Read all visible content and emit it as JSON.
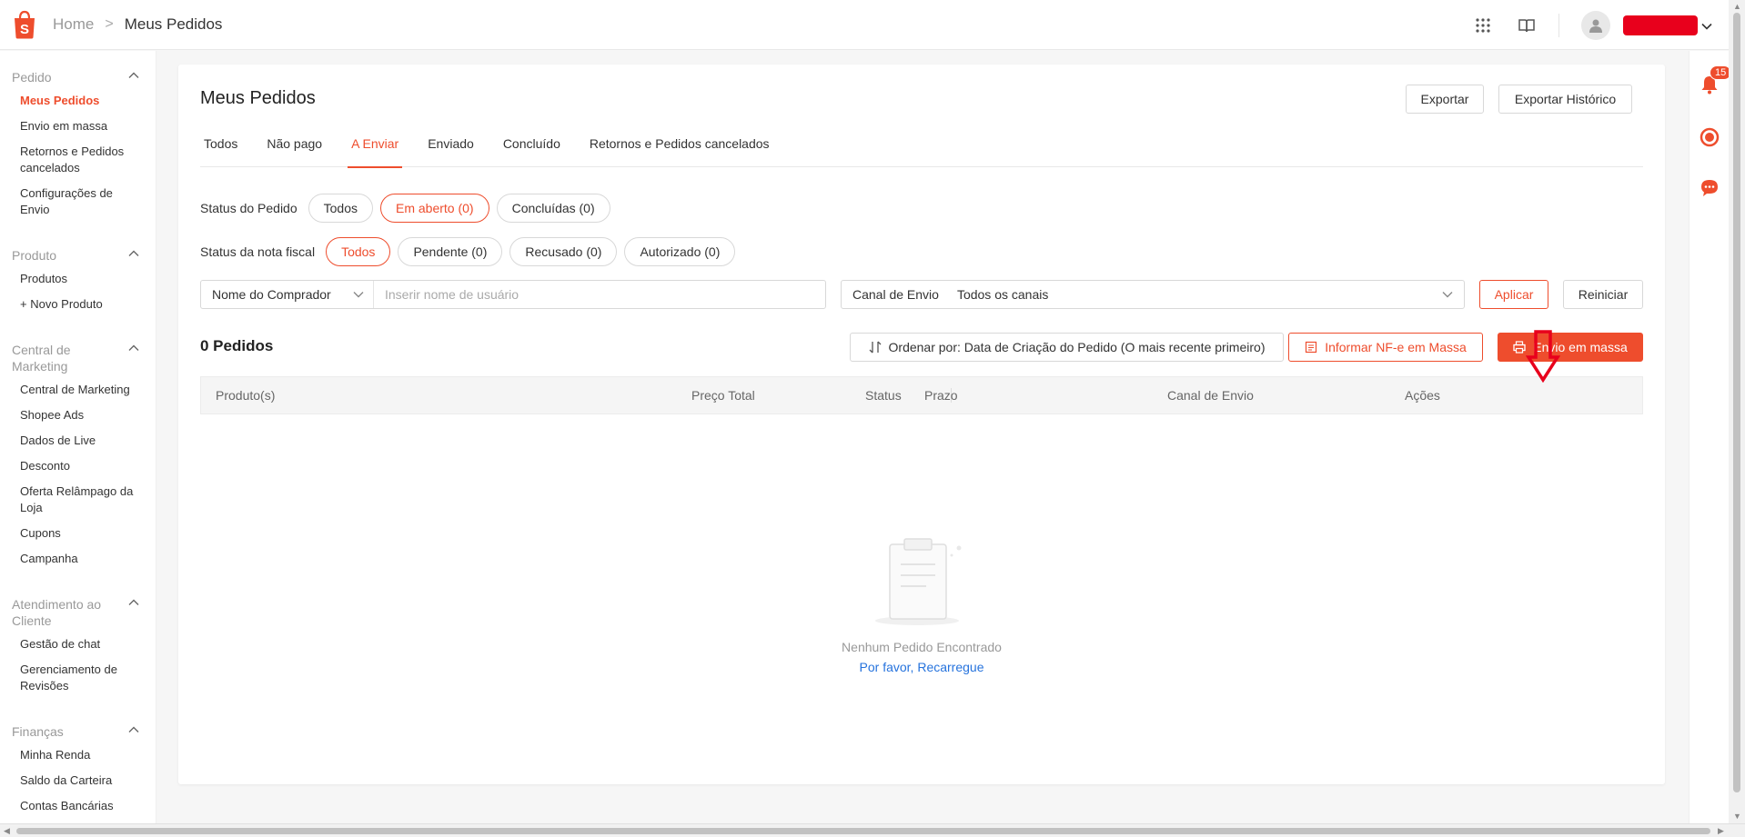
{
  "header": {
    "breadcrumb_home": "Home",
    "breadcrumb_separator": ">",
    "breadcrumb_current": "Meus Pedidos"
  },
  "sidebar": {
    "groups": [
      {
        "title": "Pedido",
        "items": [
          "Meus Pedidos",
          "Envio em massa",
          "Retornos e Pedidos cancelados",
          "Configurações de Envio"
        ]
      },
      {
        "title": "Produto",
        "items": [
          "Produtos",
          "+ Novo Produto"
        ]
      },
      {
        "title": "Central de Marketing",
        "items": [
          "Central de Marketing",
          "Shopee Ads",
          "Dados de Live",
          "Desconto",
          "Oferta Relâmpago da Loja",
          "Cupons",
          "Campanha"
        ]
      },
      {
        "title": "Atendimento ao Cliente",
        "items": [
          "Gestão de chat",
          "Gerenciamento de Revisões"
        ]
      },
      {
        "title": "Finanças",
        "items": [
          "Minha Renda",
          "Saldo da Carteira",
          "Contas Bancárias"
        ]
      }
    ],
    "active_item": "Meus Pedidos"
  },
  "notifications": {
    "count": "15"
  },
  "main": {
    "title": "Meus Pedidos",
    "export_label": "Exportar",
    "export_history_label": "Exportar Histórico",
    "tabs": [
      "Todos",
      "Não pago",
      "A Enviar",
      "Enviado",
      "Concluído",
      "Retornos e Pedidos cancelados"
    ],
    "active_tab": "A Enviar",
    "order_status": {
      "label": "Status do Pedido",
      "options": [
        "Todos",
        "Em aberto (0)",
        "Concluídas (0)"
      ],
      "active": "Em aberto (0)"
    },
    "invoice_status": {
      "label": "Status da nota fiscal",
      "options": [
        "Todos",
        "Pendente (0)",
        "Recusado (0)",
        "Autorizado (0)"
      ],
      "active": "Todos"
    },
    "search": {
      "field": "Nome do Comprador",
      "placeholder": "Inserir nome de usuário"
    },
    "channel": {
      "label": "Canal de Envio",
      "value": "Todos os canais"
    },
    "apply_label": "Aplicar",
    "reset_label": "Reiniciar",
    "order_count": "0 Pedidos",
    "sort_label": "Ordenar por: Data de Criação do Pedido (O mais recente primeiro)",
    "mass_invoice_label": "Informar NF-e em Massa",
    "mass_ship_label": "Envio em massa",
    "table_headers": [
      "Produto(s)",
      "Preço Total",
      "Status",
      "Prazo",
      "Canal de Envio",
      "Ações"
    ],
    "empty_text": "Nenhum Pedido Encontrado",
    "empty_link_prefix": "Por favor,",
    "empty_link_action": "Recarregue"
  },
  "colors": {
    "brand": "#ee4d2d",
    "link": "#2673dd",
    "annotation_arrow": "#e8001c"
  }
}
